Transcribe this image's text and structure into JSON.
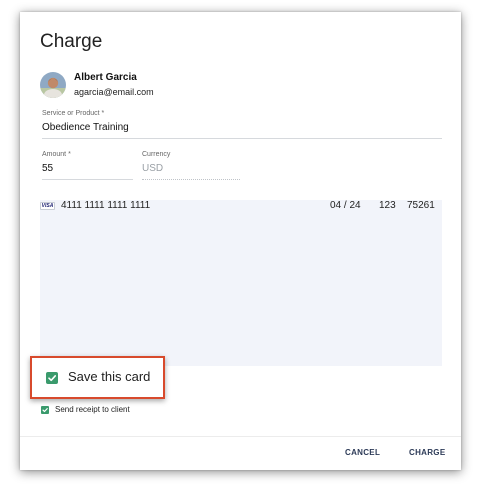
{
  "dialog": {
    "title": "Charge"
  },
  "client": {
    "name": "Albert Garcia",
    "email": "agarcia@email.com"
  },
  "service": {
    "label": "Service or Product *",
    "value": "Obedience Training"
  },
  "amount": {
    "label": "Amount *",
    "value": "55"
  },
  "currency": {
    "label": "Currency",
    "value": "USD"
  },
  "card": {
    "brand_icon": "visa-icon",
    "brand_text": "VISA",
    "number": "4111 1111 1111 1111",
    "expiry": "04 / 24",
    "cvc": "123",
    "zip": "75261"
  },
  "save_card": {
    "label": "Save this card",
    "checked": true
  },
  "send_receipt": {
    "label": "Send receipt to client",
    "checked": true
  },
  "actions": {
    "cancel_label": "CANCEL",
    "charge_label": "CHARGE"
  },
  "colors": {
    "checkbox": "#3a9a6c",
    "highlight_border": "#d84a2c",
    "button_text": "#2c3a57",
    "card_area_bg": "#f2f4fa"
  }
}
